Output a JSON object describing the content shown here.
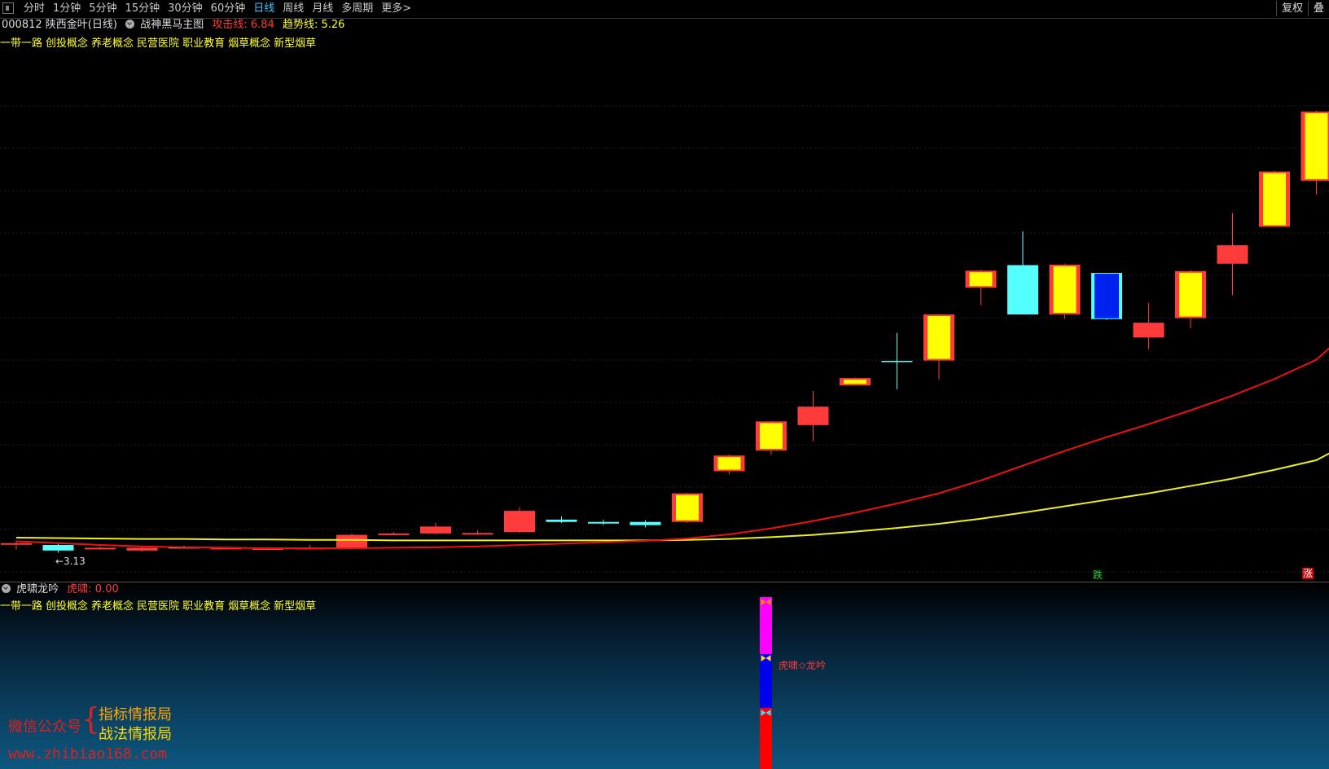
{
  "toolbar": {
    "tabs": [
      "分时",
      "1分钟",
      "5分钟",
      "15分钟",
      "30分钟",
      "60分钟",
      "日线",
      "周线",
      "月线",
      "多周期",
      "更多"
    ],
    "active_tab": "日线",
    "right_buttons": [
      "复权",
      "叠"
    ]
  },
  "header": {
    "stock": "000812 陕西金叶(日线)",
    "indicator": "战神黑马主图",
    "attack_label": "攻击线: 6.84",
    "trend_label": "趋势线: 5.26"
  },
  "concepts": [
    "一带一路",
    "创投概念",
    "养老概念",
    "民营医院",
    "职业教育",
    "烟草概念",
    "新型烟草"
  ],
  "main": {
    "low_label": "←3.13",
    "tag_down": "跌",
    "tag_up": "涨"
  },
  "sub": {
    "indicator": "虎啸龙吟",
    "value_label": "虎啸: 0.00",
    "signal_label": "虎啸✩龙吟"
  },
  "watermark": {
    "line1": "微信公众号",
    "brace": "{",
    "line2": "指标情报局",
    "line3": "战法情报局",
    "url": "www.zhibiao168.com"
  },
  "colors": {
    "up_hollow": "#ff3b3b",
    "yellow_body": "#ffff00",
    "down_cyan": "#54ffff",
    "down_blue": "#0022ee",
    "attack_line": "#ee1111",
    "trend_line": "#eeee22",
    "bar_magenta": "#ff00ff",
    "bar_blue": "#0000ee",
    "bar_red": "#ff0000"
  },
  "candles": [
    {
      "type": "flat-red",
      "o": 3.32,
      "c": 3.34,
      "h": 3.4,
      "l": 3.2
    },
    {
      "type": "cyan",
      "o": 3.3,
      "c": 3.18,
      "h": 3.32,
      "l": 3.13
    },
    {
      "type": "flat-red",
      "o": 3.22,
      "c": 3.24,
      "h": 3.27,
      "l": 3.2
    },
    {
      "type": "red",
      "o": 3.18,
      "c": 3.24,
      "h": 3.27,
      "l": 3.16
    },
    {
      "type": "flat-white",
      "o": 3.25,
      "c": 3.26,
      "h": 3.28,
      "l": 3.24
    },
    {
      "type": "flat-red",
      "o": 3.23,
      "c": 3.24,
      "h": 3.26,
      "l": 3.22
    },
    {
      "type": "flat-red",
      "o": 3.22,
      "c": 3.23,
      "h": 3.26,
      "l": 3.21
    },
    {
      "type": "flat-red",
      "o": 3.22,
      "c": 3.24,
      "h": 3.3,
      "l": 3.2
    },
    {
      "type": "red",
      "o": 3.24,
      "c": 3.52,
      "h": 3.55,
      "l": 3.22
    },
    {
      "type": "flat-red",
      "o": 3.54,
      "c": 3.55,
      "h": 3.58,
      "l": 3.52
    },
    {
      "type": "red",
      "o": 3.55,
      "c": 3.7,
      "h": 3.78,
      "l": 3.53
    },
    {
      "type": "flat-red",
      "o": 3.54,
      "c": 3.56,
      "h": 3.62,
      "l": 3.52
    },
    {
      "type": "red",
      "o": 3.58,
      "c": 4.04,
      "h": 4.12,
      "l": 3.56
    },
    {
      "type": "cyan",
      "o": 3.85,
      "c": 3.8,
      "h": 3.92,
      "l": 3.78
    },
    {
      "type": "cyan",
      "o": 3.8,
      "c": 3.77,
      "h": 3.85,
      "l": 3.73
    },
    {
      "type": "cyan",
      "o": 3.8,
      "c": 3.73,
      "h": 3.84,
      "l": 3.68
    },
    {
      "type": "yellow",
      "o": 3.8,
      "c": 4.42,
      "h": 4.43,
      "l": 3.78
    },
    {
      "type": "yellow",
      "o": 4.9,
      "c": 5.24,
      "h": 5.26,
      "l": 4.83
    },
    {
      "type": "yellow",
      "o": 5.35,
      "c": 5.98,
      "h": 5.99,
      "l": 5.25
    },
    {
      "type": "red",
      "o": 5.9,
      "c": 6.3,
      "h": 6.64,
      "l": 5.55
    },
    {
      "type": "yellow",
      "o": 6.76,
      "c": 6.92,
      "h": 6.93,
      "l": 6.76
    },
    {
      "type": "cyan-cross",
      "o": 7.28,
      "c": 7.28,
      "h": 7.9,
      "l": 6.68
    },
    {
      "type": "yellow",
      "o": 7.3,
      "c": 8.3,
      "h": 8.31,
      "l": 6.89
    },
    {
      "type": "yellow",
      "o": 8.88,
      "c": 9.25,
      "h": 9.27,
      "l": 8.5
    },
    {
      "type": "cyan",
      "o": 9.37,
      "c": 8.3,
      "h": 10.1,
      "l": 8.3
    },
    {
      "type": "yellow",
      "o": 8.3,
      "c": 9.38,
      "h": 9.4,
      "l": 8.2
    },
    {
      "type": "blue",
      "o": 9.2,
      "c": 8.2,
      "h": 9.2,
      "l": 8.18
    },
    {
      "type": "red",
      "o": 7.8,
      "c": 8.12,
      "h": 8.55,
      "l": 7.55
    },
    {
      "type": "yellow",
      "o": 8.22,
      "c": 9.24,
      "h": 9.26,
      "l": 8.0
    },
    {
      "type": "red",
      "o": 9.4,
      "c": 9.8,
      "h": 10.5,
      "l": 8.72
    },
    {
      "type": "yellow",
      "o": 10.2,
      "c": 11.4,
      "h": 11.42,
      "l": 10.2
    },
    {
      "type": "yellow",
      "o": 11.2,
      "c": 12.7,
      "h": 12.72,
      "l": 10.9
    }
  ],
  "attack_line": [
    3.38,
    3.34,
    3.3,
    3.27,
    3.25,
    3.24,
    3.23,
    3.23,
    3.23,
    3.24,
    3.25,
    3.27,
    3.3,
    3.33,
    3.36,
    3.39,
    3.44,
    3.53,
    3.66,
    3.82,
    4.0,
    4.2,
    4.42,
    4.7,
    5.02,
    5.34,
    5.64,
    5.92,
    6.22,
    6.54,
    6.9,
    7.32,
    7.72
  ],
  "trend_line": [
    3.46,
    3.45,
    3.44,
    3.43,
    3.43,
    3.42,
    3.42,
    3.41,
    3.41,
    3.4,
    3.4,
    3.4,
    3.4,
    3.4,
    3.4,
    3.4,
    3.41,
    3.43,
    3.47,
    3.52,
    3.59,
    3.67,
    3.76,
    3.87,
    4.0,
    4.14,
    4.28,
    4.42,
    4.58,
    4.74,
    4.93,
    5.14,
    5.38
  ],
  "chart_data": {
    "type": "candlestick",
    "ylim": [
      3.0,
      13.0
    ]
  }
}
